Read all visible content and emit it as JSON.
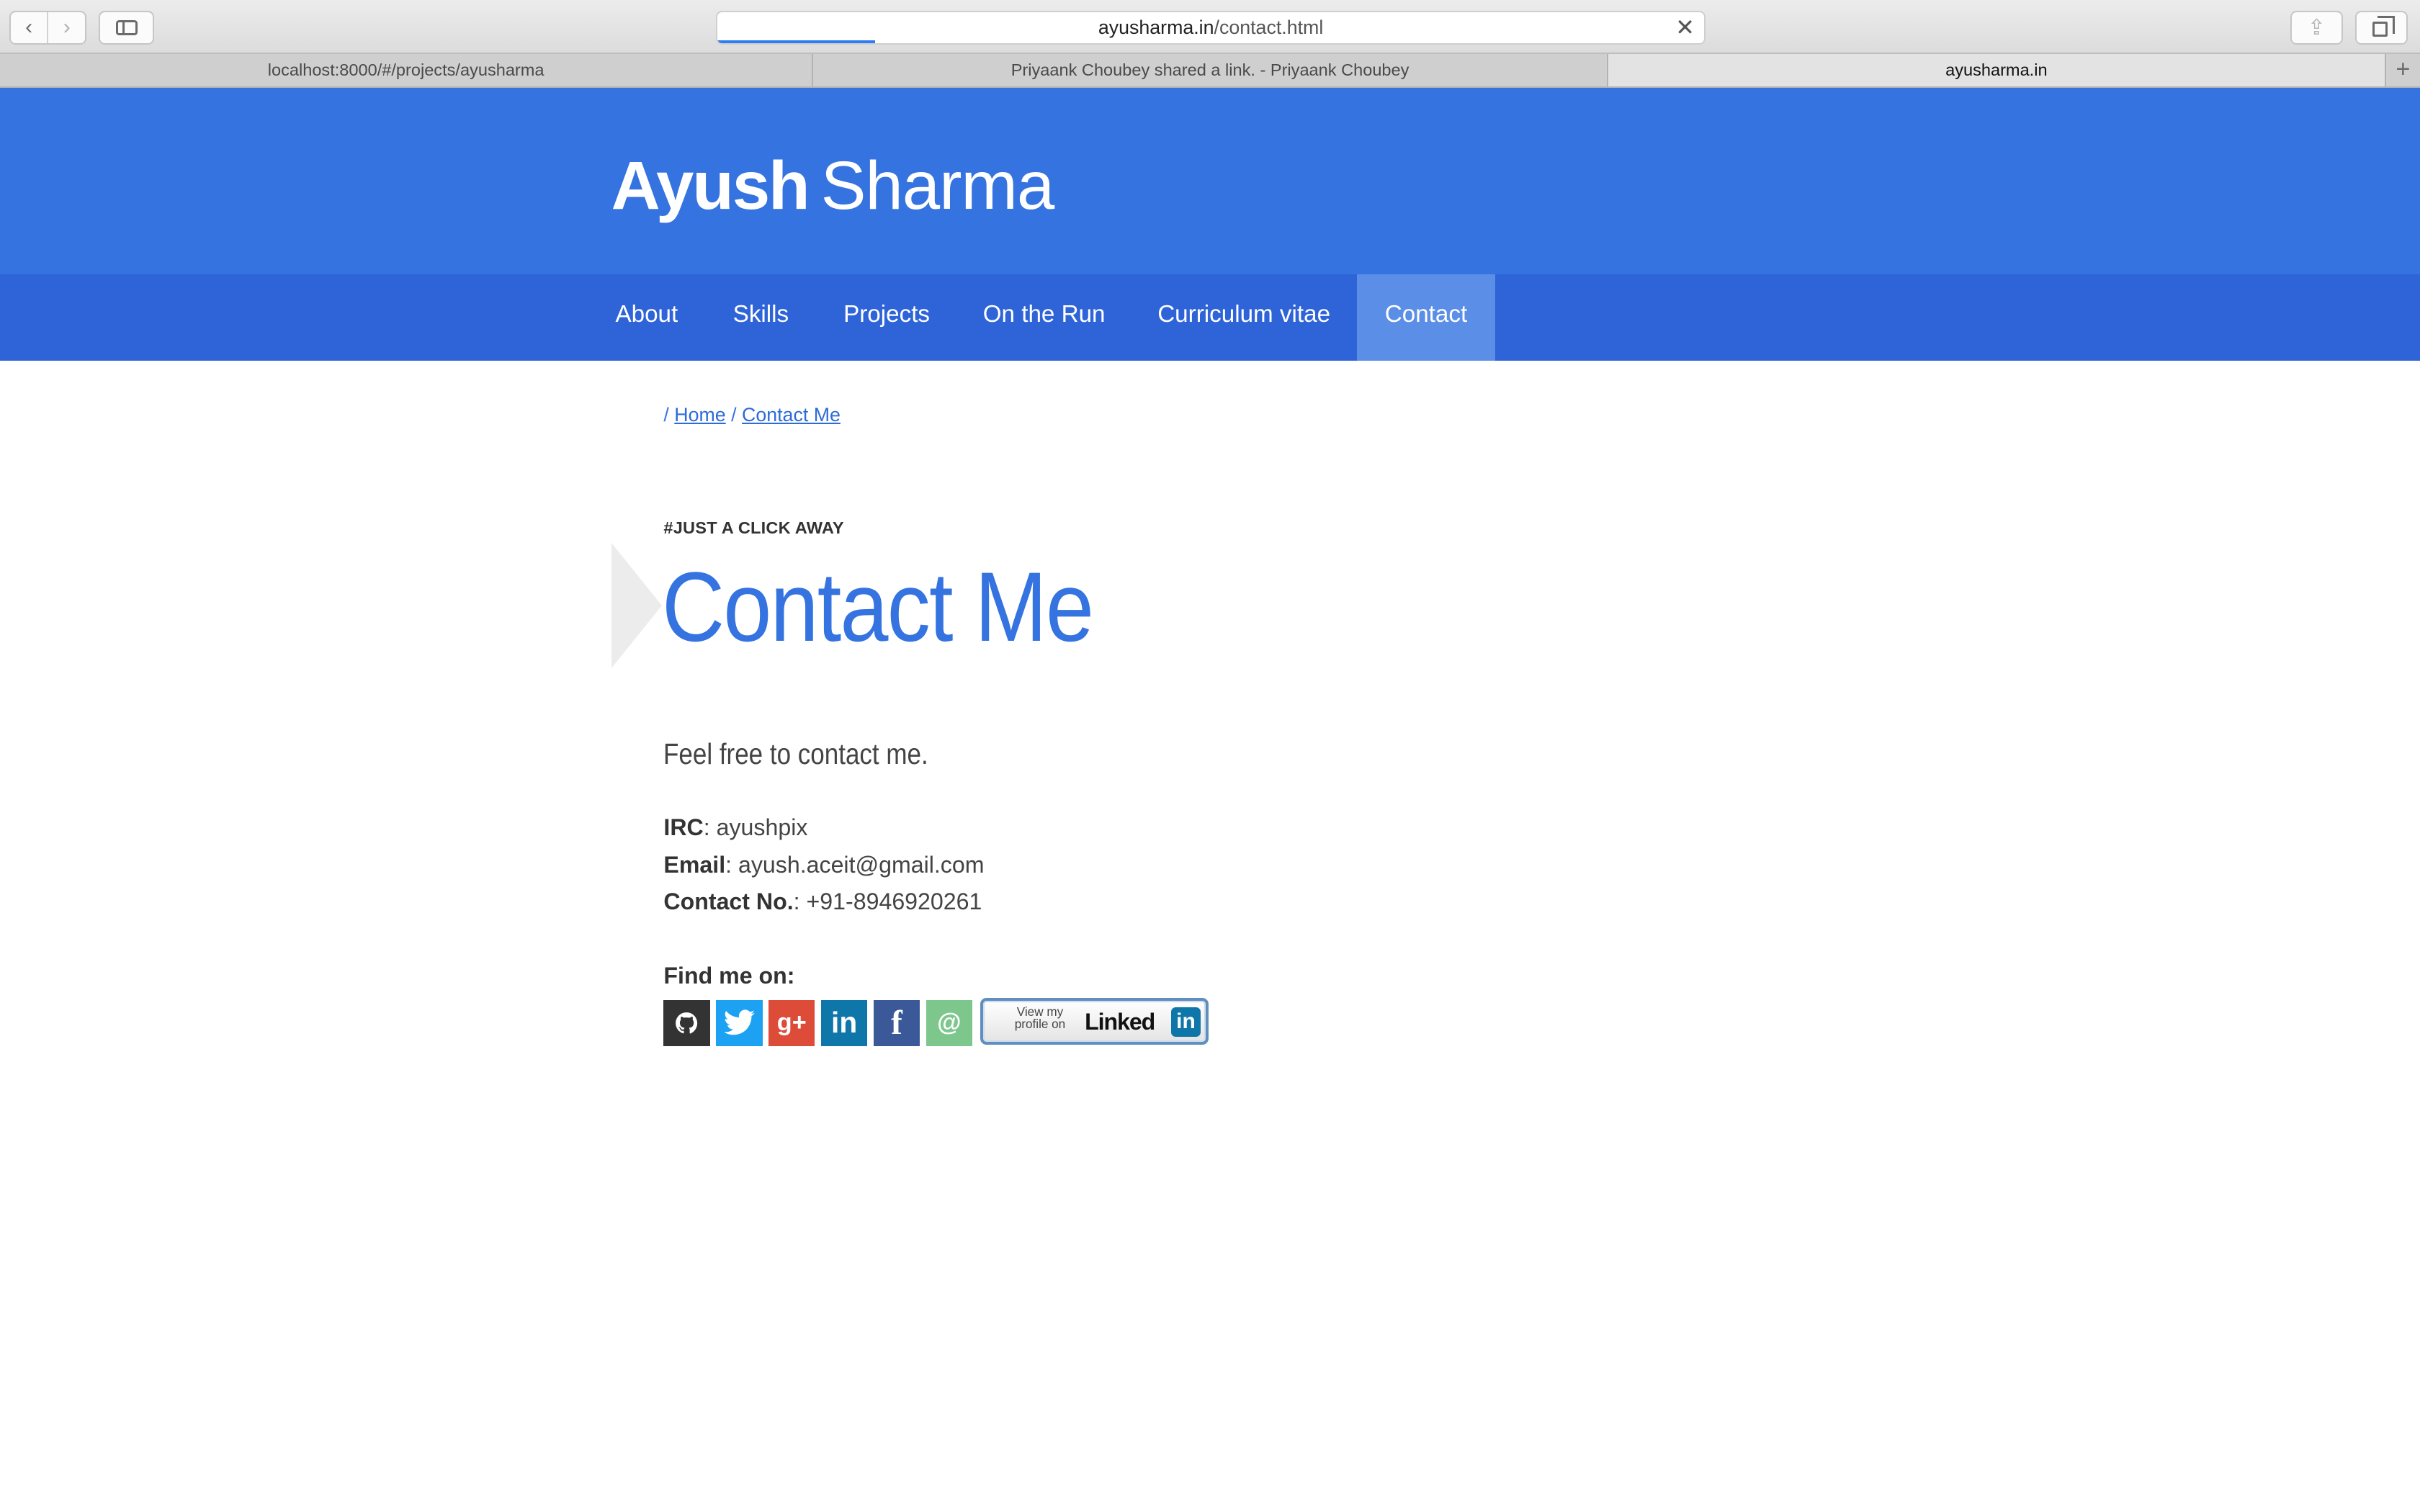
{
  "browser": {
    "back_icon": "‹",
    "forward_icon": "›",
    "url_host": "ayusharma.in",
    "url_path": "/contact.html",
    "page_load_progress": 0.16,
    "stop_icon": "✕",
    "tabs": [
      {
        "title": "localhost:8000/#/projects/ayusharma"
      },
      {
        "title": "Priyaank Choubey shared a link. - Priyaank Choubey"
      },
      {
        "title": "ayusharma.in"
      }
    ],
    "new_tab_icon": "+",
    "share_icon": "⇪"
  },
  "site": {
    "brand_first": "Ayush",
    "brand_last": "Sharma",
    "nav": [
      {
        "label": "About"
      },
      {
        "label": "Skills"
      },
      {
        "label": "Projects"
      },
      {
        "label": "On the Run"
      },
      {
        "label": "Curriculum vitae"
      },
      {
        "label": "Contact",
        "active": true
      }
    ],
    "accent_color": "#3573e0"
  },
  "breadcrumb": {
    "sep": "/",
    "home": "Home",
    "current": "Contact Me"
  },
  "content": {
    "kicker": "#JUST A CLICK AWAY",
    "title": "Contact Me",
    "intro": "Feel free to contact me.",
    "irc_label": "IRC",
    "irc_value": ": ayushpix",
    "email_label": "Email",
    "email_value": ": ayush.aceit@gmail.com",
    "phone_label": "Contact No.",
    "phone_value": ": +91-8946920261",
    "find_label": "Find me on:"
  },
  "social": {
    "github_icon": "github-icon",
    "twitter_icon": "twitter-icon",
    "google_icon": "g+",
    "linkedin_icon": "in",
    "facebook_icon": "f",
    "email_icon": "@",
    "badge_small": "View my profile on",
    "badge_word": "Linked",
    "badge_in": "in"
  }
}
